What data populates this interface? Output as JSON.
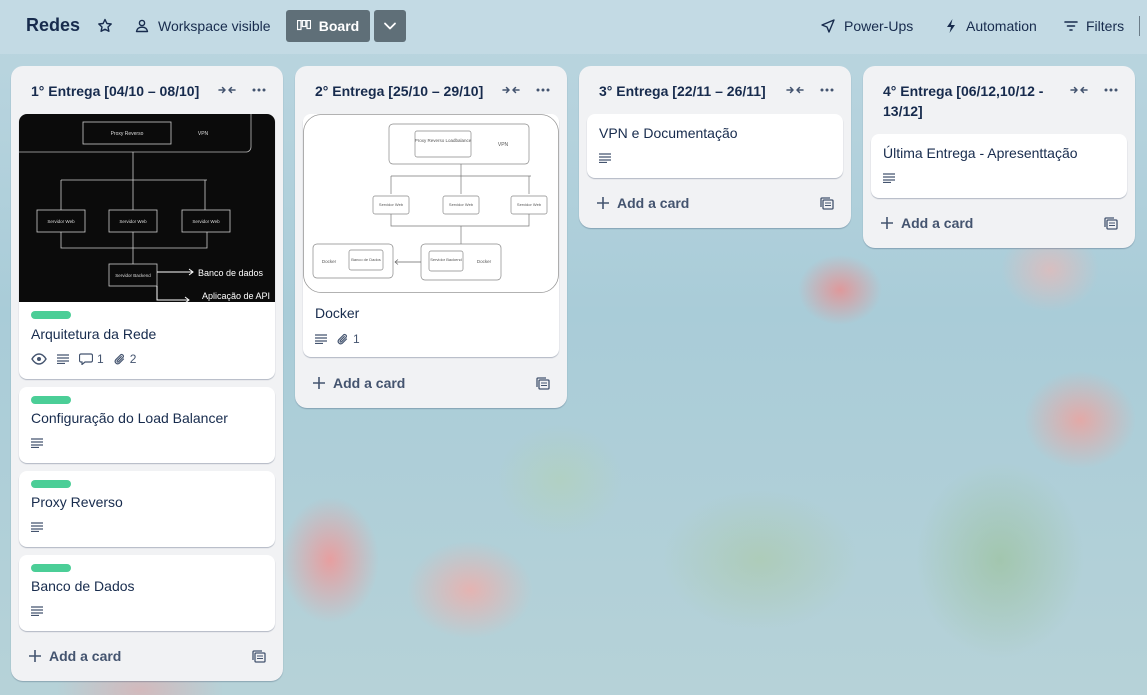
{
  "header": {
    "board_title": "Redes",
    "visibility_label": "Workspace visible",
    "view_label": "Board",
    "powerups_label": "Power-Ups",
    "automation_label": "Automation",
    "filters_label": "Filters"
  },
  "colors": {
    "label_green": "#4bce97",
    "list_bg": "#f1f2f4",
    "header_view_bg": "#5f6f78"
  },
  "add_card_label": "Add a card",
  "lists": [
    {
      "title": "1° Entrega [04/10 – 08/10]",
      "cards": [
        {
          "title": "Arquitetura da Rede",
          "badges": {
            "comments": "1",
            "attachments": "2"
          },
          "cover": {
            "proxy": "Proxy Reverso",
            "vpn": "VPN",
            "web1": "Servidor Web",
            "web2": "Servidor Web",
            "web3": "Servidor Web",
            "backend": "Servidor Backend",
            "db": "Banco de dados",
            "api": "Aplicação de API"
          }
        },
        {
          "title": "Configuração do Load Balancer"
        },
        {
          "title": "Proxy Reverso"
        },
        {
          "title": "Banco de Dados"
        }
      ]
    },
    {
      "title": "2° Entrega [25/10 – 29/10]",
      "cards": [
        {
          "title": "Docker",
          "badges": {
            "attachments": "1"
          },
          "cover": {
            "proxy": "Proxy Reverso Loadbalance",
            "vpn": "VPN",
            "web1": "Servidor Web",
            "web2": "Servidor Web",
            "web3": "Servidor Web",
            "docker1": "Docker",
            "db": "Banco de Dados",
            "backend": "Servidor Backend",
            "docker2": "Docker"
          }
        }
      ]
    },
    {
      "title": "3° Entrega [22/11 – 26/11]",
      "cards": [
        {
          "title": "VPN e Documentação"
        }
      ]
    },
    {
      "title_line1": "4° Entrega [06/12,10/12 -",
      "title_line2": "13/12]",
      "cards": [
        {
          "title": "Última Entrega - Apresenttação"
        }
      ]
    }
  ]
}
